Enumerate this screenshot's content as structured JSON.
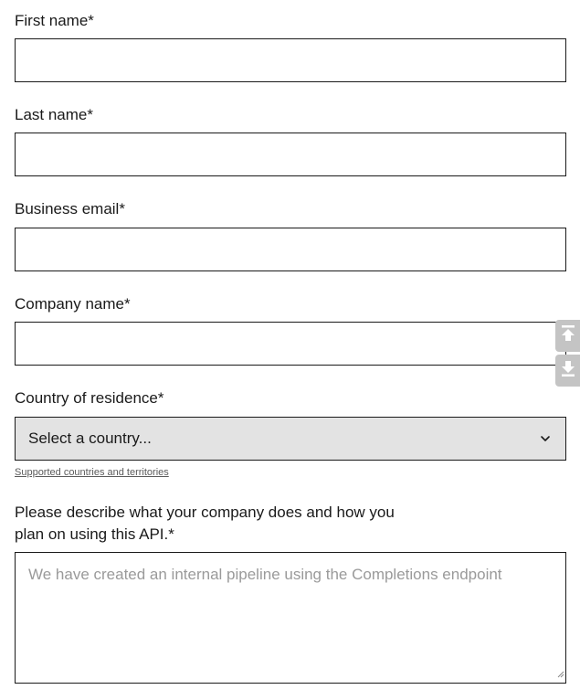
{
  "form": {
    "first_name": {
      "label": "First name*",
      "value": ""
    },
    "last_name": {
      "label": "Last name*",
      "value": ""
    },
    "business_email": {
      "label": "Business email*",
      "value": ""
    },
    "company_name": {
      "label": "Company name*",
      "value": ""
    },
    "country": {
      "label": "Country of residence*",
      "selected": "Select a country...",
      "helper_link": "Supported countries and territories",
      "icon": "chevron-down-icon"
    },
    "description": {
      "label": "Please describe what your company does and how you plan on using this API.*",
      "placeholder": "We have created an internal pipeline using the Completions endpoint",
      "value": ""
    }
  },
  "scroll_controls": {
    "up_icon": "scroll-to-top-icon",
    "down_icon": "scroll-to-bottom-icon"
  },
  "colors": {
    "border": "#1a1a1a",
    "select_bg": "#e3e3e3",
    "placeholder": "#9a9a9a",
    "scroll_widget": "#c4c4c4"
  }
}
